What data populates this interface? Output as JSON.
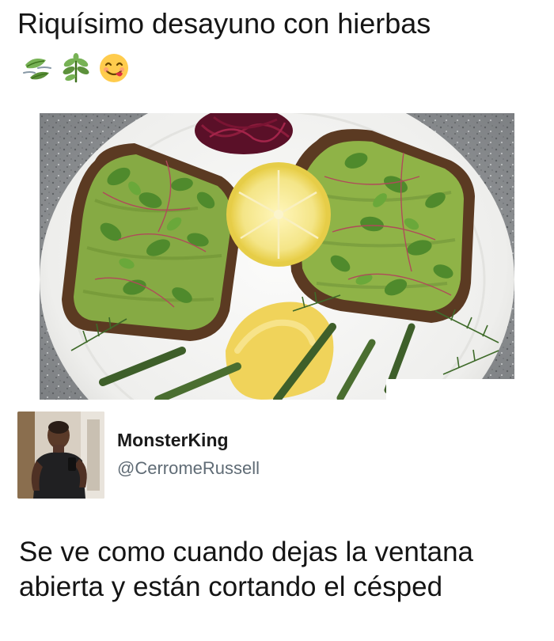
{
  "post": {
    "caption": "Riquísimo desayuno con hierbas",
    "emojis": [
      "leaf-fluttering-in-wind",
      "herb",
      "face-savoring-food"
    ]
  },
  "image": {
    "subject": "avocado-toast-with-microgreens"
  },
  "tweet": {
    "display_name": "MonsterKing",
    "handle": "@CerromeRussell",
    "text": "Se ve como cuando dejas la ventana abierta y están cortando el césped"
  }
}
